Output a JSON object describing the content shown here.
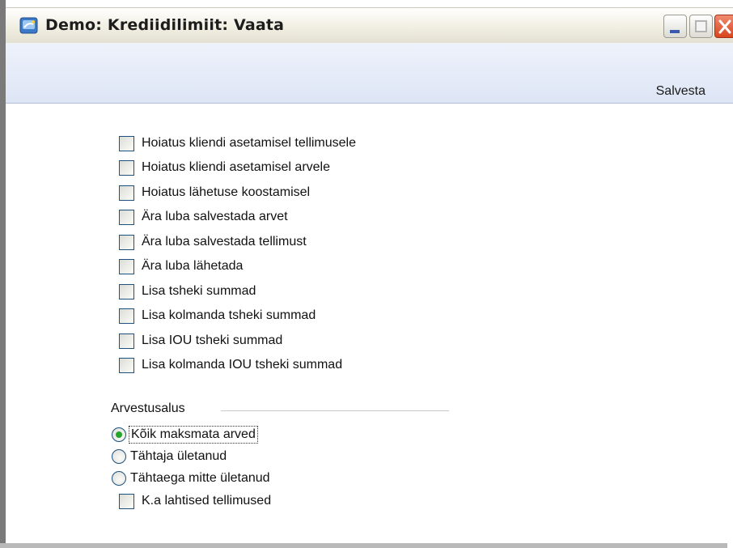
{
  "window": {
    "title": "Demo: Krediidilimiit: Vaata"
  },
  "toolbar": {
    "save_label": "Salvesta"
  },
  "checkboxes": [
    {
      "label": "Hoiatus kliendi asetamisel tellimusele",
      "checked": false
    },
    {
      "label": "Hoiatus kliendi asetamisel arvele",
      "checked": false
    },
    {
      "label": "Hoiatus lähetuse koostamisel",
      "checked": false
    },
    {
      "label": "Ära luba salvestada arvet",
      "checked": false
    },
    {
      "label": "Ära luba salvestada tellimust",
      "checked": false
    },
    {
      "label": "Ära luba lähetada",
      "checked": false
    },
    {
      "label": "Lisa tsheki summad",
      "checked": false
    },
    {
      "label": "Lisa kolmanda tsheki summad",
      "checked": false
    },
    {
      "label": "Lisa IOU tsheki summad",
      "checked": false
    },
    {
      "label": "Lisa kolmanda IOU tsheki summad",
      "checked": false
    }
  ],
  "basis": {
    "title": "Arvestusalus",
    "options": [
      {
        "label": "Kõik maksmata arved",
        "selected": true
      },
      {
        "label": "Tähtaja ületanud",
        "selected": false
      },
      {
        "label": "Tähtaega mitte ületanud",
        "selected": false
      }
    ],
    "extra_checkbox": {
      "label": "K.a lahtised tellimused",
      "checked": false
    }
  },
  "colors": {
    "toolbar_bg": "#dde5f5",
    "close_button": "#d8451d",
    "checkbox_border": "#1c5180",
    "radio_dot": "#22a52a"
  },
  "icons": {
    "app": "app-icon",
    "minimize": "minimize-icon",
    "maximize": "maximize-icon",
    "close": "close-icon"
  }
}
